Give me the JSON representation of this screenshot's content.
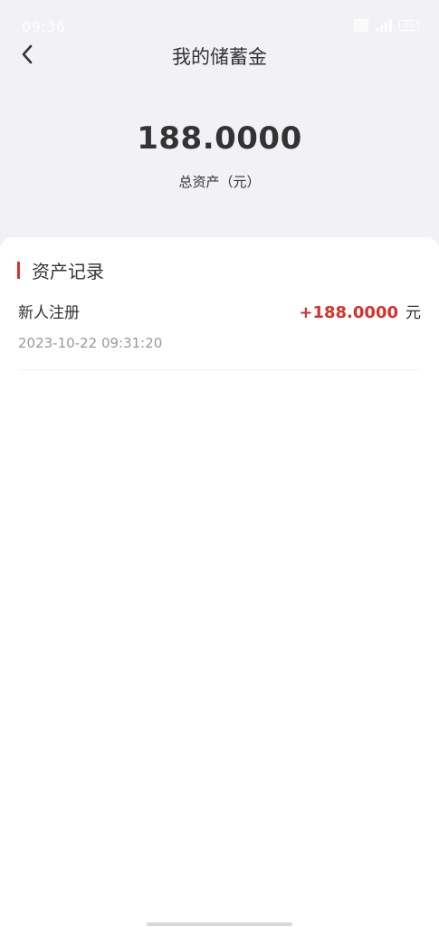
{
  "status_bar": {
    "time": "09:36",
    "hd_label": "HD",
    "battery": "95"
  },
  "header": {
    "title": "我的储蓄金",
    "back_icon": "chevron-left-icon"
  },
  "summary": {
    "total_amount": "188.0000",
    "total_label": "总资产（元）"
  },
  "records": {
    "section_title": "资产记录",
    "accent_color": "#d6312c",
    "items": [
      {
        "name": "新人注册",
        "amount": "+188.0000",
        "unit": "元",
        "time": "2023-10-22 09:31:20"
      }
    ]
  }
}
